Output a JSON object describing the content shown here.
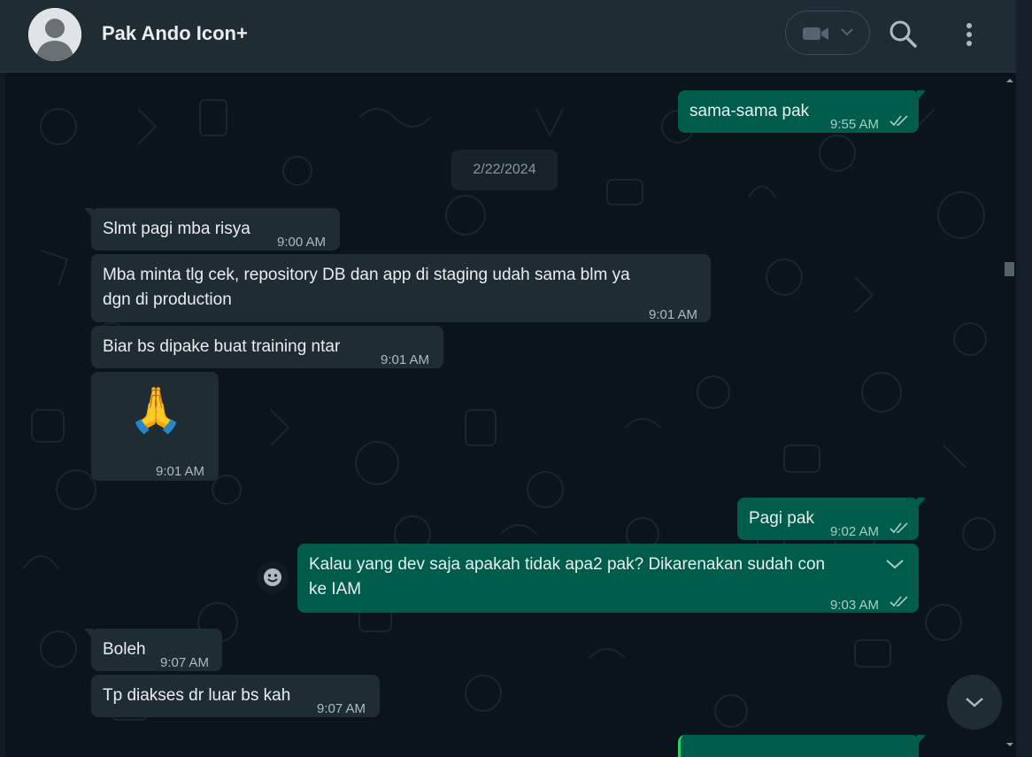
{
  "header": {
    "contact_name": "Pak Ando Icon+",
    "icons": {
      "avatar": "default-avatar",
      "video_call": "video-camera-icon",
      "dropdown": "chevron-down-icon",
      "search": "search-icon",
      "menu": "kebab-menu-icon"
    }
  },
  "colors": {
    "incoming_bubble": "#202c33",
    "outgoing_bubble": "#005c4b",
    "chat_background": "#0b141a",
    "header_background": "#202c33",
    "read_ticks": "#a7cdc4"
  },
  "date_separator": "2/22/2024",
  "messages": [
    {
      "direction": "out",
      "text": "sama-sama pak",
      "time": "9:55 AM",
      "status": "read"
    },
    {
      "direction": "in",
      "text": "Slmt pagi mba risya",
      "time": "9:00 AM"
    },
    {
      "direction": "in",
      "text_line1": "Mba minta tlg cek, repository DB dan app di staging udah sama blm ya",
      "text_line2": "dgn di production",
      "time": "9:01 AM"
    },
    {
      "direction": "in",
      "text": "Biar bs dipake buat training ntar",
      "time": "9:01 AM"
    },
    {
      "direction": "in",
      "emoji": "🙏",
      "time": "9:01 AM"
    },
    {
      "direction": "out",
      "text": "Pagi pak",
      "time": "9:02 AM",
      "status": "read"
    },
    {
      "direction": "out",
      "text_line1": "Kalau yang dev saja apakah tidak apa2 pak? Dikarenakan sudah con",
      "text_line2": "ke IAM",
      "time": "9:03 AM",
      "status": "read"
    },
    {
      "direction": "in",
      "text": "Boleh",
      "time": "9:07 AM"
    },
    {
      "direction": "in",
      "text": "Tp diakses dr luar bs kah",
      "time": "9:07 AM"
    }
  ],
  "controls": {
    "react_icon": "emoji-smile-icon",
    "message_menu_icon": "chevron-down-icon",
    "scroll_to_bottom_icon": "chevron-down-icon"
  }
}
